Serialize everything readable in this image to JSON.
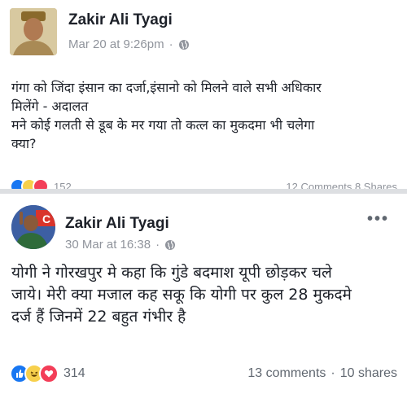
{
  "post1": {
    "author": "Zakir Ali Tyagi",
    "timestamp": "Mar 20 at 9:26pm",
    "separator": "·",
    "privacy_icon": "globe-icon",
    "lines": [
      "गंगा को जिंदा इंसान का दर्जा,इंसानो को मिलने वाले सभी अधिकार",
      "मिलेंगे - अदालत",
      "मने कोई गलती से डूब के मर गया तो कत्ल का मुकदमा भी चलेगा",
      "क्या?"
    ],
    "reaction_count": "152",
    "stats": "12 Comments 8 Shares"
  },
  "post2": {
    "author": "Zakir Ali Tyagi",
    "timestamp": "30 Mar at 16:38",
    "separator": "·",
    "privacy_icon": "globe-icon",
    "more_label": "•••",
    "lines": [
      "योगी ने गोरखपुर मे कहा कि गुंडे बदमाश यूपी छोड़कर चले",
      "जाये। मेरी क्या मजाल कह सकू कि योगी पर कुल 28 मुकदमे",
      "दर्ज हैं जिनमें 22 बहुत गंभीर है"
    ],
    "reaction_count": "314",
    "comments": "13 comments",
    "dot": "·",
    "shares": "10 shares"
  },
  "colors": {
    "like": "#1877f2",
    "haha": "#f7d04c",
    "love": "#f33e58",
    "meta_text": "#90949c",
    "divider": "#dddfe2"
  }
}
